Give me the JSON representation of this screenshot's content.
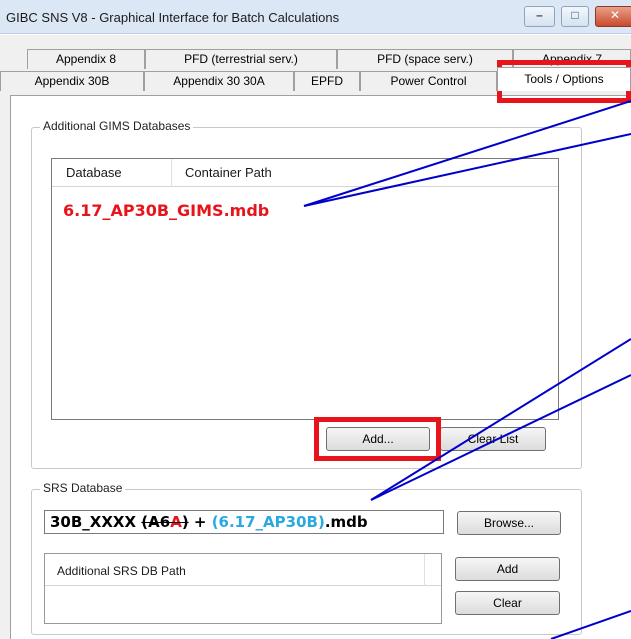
{
  "window": {
    "title": "GIBC SNS V8 - Graphical Interface for Batch Calculations",
    "minimize_glyph": "–",
    "maximize_glyph": "□",
    "close_glyph": "✕"
  },
  "tabs_row1": [
    {
      "label": "Appendix 8"
    },
    {
      "label": "PFD (terrestrial serv.)"
    },
    {
      "label": "PFD (space serv.)"
    },
    {
      "label": "Appendix 7"
    }
  ],
  "tabs_row2": [
    {
      "label": "Appendix 30B"
    },
    {
      "label": "Appendix 30 30A"
    },
    {
      "label": "EPFD"
    },
    {
      "label": "Power Control"
    },
    {
      "label": "Tools / Options",
      "active": true
    }
  ],
  "gims_group": {
    "title": "Additional GIMS Databases",
    "columns": [
      "Database",
      "Container Path"
    ],
    "rows": [
      {
        "database": "6.17_AP30B_GIMS.mdb"
      }
    ],
    "add_label": "Add...",
    "clear_label": "Clear List"
  },
  "srs_group": {
    "title": "SRS Database",
    "path_parts": {
      "p1": "30B_XXXX ",
      "p2": "(A6",
      "p3": "A",
      "p4": ")",
      "p5": " + ",
      "p6": "(6.17_AP30B)",
      "p7": ".mdb"
    },
    "browse_label": "Browse...",
    "additional_header": "Additional SRS DB Path",
    "add_label": "Add",
    "clear_label": "Clear"
  },
  "colors": {
    "highlight": "#e8141c",
    "annotation_line": "#0000cc",
    "accent_blue": "#2aa9e0"
  }
}
